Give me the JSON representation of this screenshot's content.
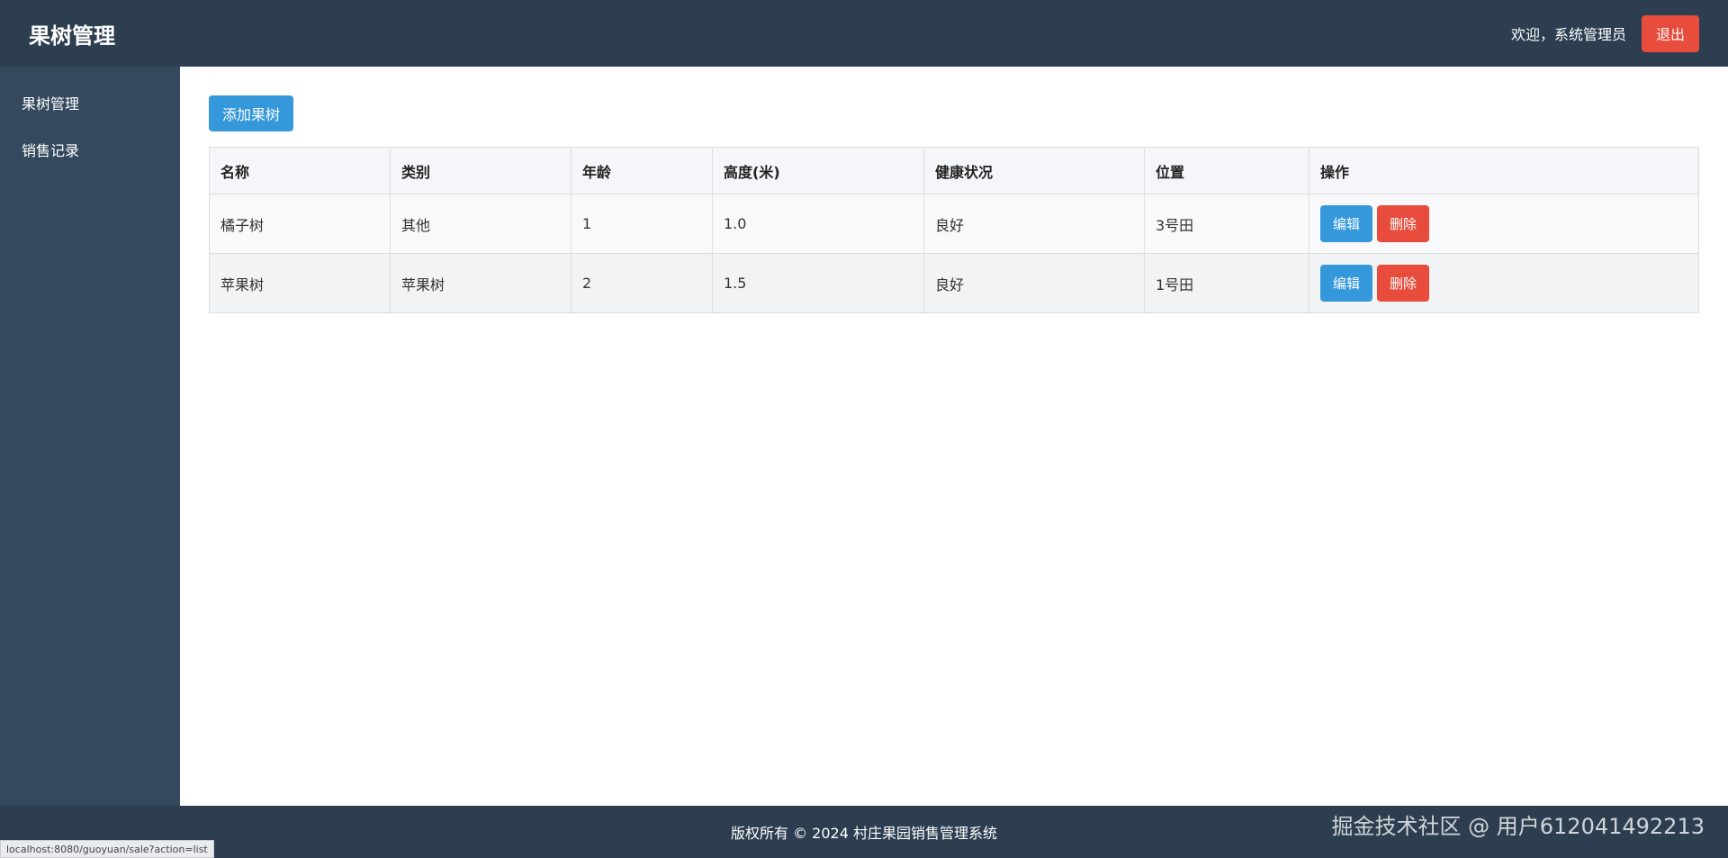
{
  "header": {
    "title": "果树管理",
    "welcome": "欢迎，系统管理员",
    "logout_label": "退出"
  },
  "sidebar": {
    "items": [
      {
        "label": "果树管理"
      },
      {
        "label": "销售记录"
      }
    ]
  },
  "main": {
    "add_button_label": "添加果树",
    "table": {
      "headers": [
        "名称",
        "类别",
        "年龄",
        "高度(米)",
        "健康状况",
        "位置",
        "操作"
      ],
      "rows": [
        {
          "name": "橘子树",
          "category": "其他",
          "age": "1",
          "height": "1.0",
          "health": "良好",
          "location": "3号田",
          "edit_label": "编辑",
          "delete_label": "删除"
        },
        {
          "name": "苹果树",
          "category": "苹果树",
          "age": "2",
          "height": "1.5",
          "health": "良好",
          "location": "1号田",
          "edit_label": "编辑",
          "delete_label": "删除"
        }
      ]
    }
  },
  "footer": {
    "copyright": "版权所有 © 2024 村庄果园销售管理系统",
    "watermark": "掘金技术社区 @ 用户612041492213"
  },
  "status_bar": {
    "url": "localhost:8080/guoyuan/sale?action=list"
  },
  "colors": {
    "header_bg": "#2c3e50",
    "sidebar_bg": "#34495e",
    "primary": "#3498db",
    "danger": "#e74c3c"
  }
}
